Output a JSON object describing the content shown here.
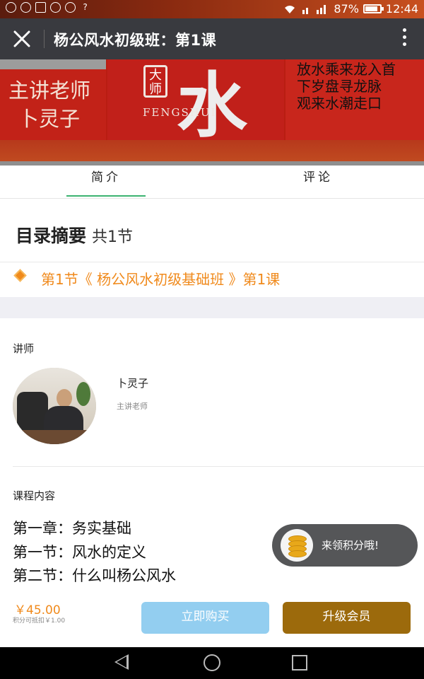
{
  "status": {
    "battery": "87%",
    "time": "12:44",
    "battery_level": 0.87
  },
  "titlebar": {
    "title": "杨公风水初级班：第1课"
  },
  "banner": {
    "teacher_role": "主讲老师",
    "teacher_name": "卜灵子",
    "badge": "大师",
    "fengshui": "FENGSHUI",
    "brush_char": "水",
    "poem": "放水乘来龙入首\n下岁盘寻龙脉\n观来水潮走口"
  },
  "tabs": [
    {
      "label": "简介",
      "active": true
    },
    {
      "label": "评论",
      "active": false
    }
  ],
  "catalog": {
    "heading": "目录摘要",
    "count": "共1节",
    "lesson": "第1节《 杨公风水初级基础班 》第1课"
  },
  "instructor": {
    "section_label": "讲师",
    "name": "卜灵子",
    "title": "主讲老师"
  },
  "course": {
    "section_label": "课程内容",
    "lines": [
      "第一章：务实基础",
      "第一节：风水的定义",
      "第二节：什么叫杨公风水"
    ]
  },
  "toast": {
    "text": "来领积分哦!"
  },
  "purchase": {
    "price": "￥45.00",
    "note": "积分可抵扣￥1.00",
    "buy_label": "立即购买",
    "vip_label": "升级会员"
  },
  "colors": {
    "accent_orange": "#f08a1c",
    "tab_green": "#3cb371",
    "buy_blue": "#93cef0",
    "vip_gold": "#9c6a0c"
  }
}
